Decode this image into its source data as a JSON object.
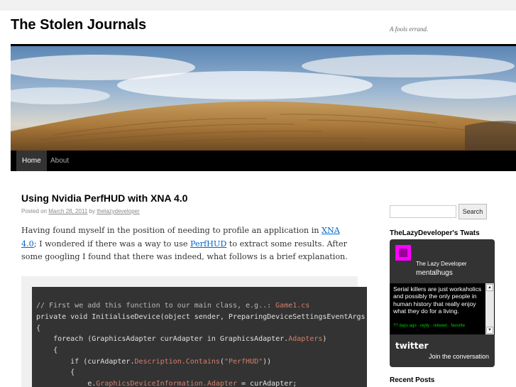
{
  "site": {
    "title": "The Stolen Journals",
    "description": "A fools errand."
  },
  "nav": {
    "items": [
      {
        "label": "Home"
      },
      {
        "label": "About"
      }
    ]
  },
  "post": {
    "title": "Using Nvidia PerfHUD with XNA 4.0",
    "meta_posted_on": "Posted on",
    "meta_date": "March 28, 2011",
    "meta_by": "by",
    "meta_author": "thelazydeveloper",
    "body_part1": "Having found myself in the position of needing to profile an application in ",
    "body_link1": "XNA 4.0",
    "body_part2": "; I wondered if there was a way to use ",
    "body_link2": "PerfHUD",
    "body_part3": " to extract some results. After some googling I found that there was indeed, what follows is a brief explanation."
  },
  "code": {
    "line1_comment": "// First we add this function to our main class, e.g..: ",
    "line1_file": "Game1.cs",
    "line2": "private void InitialiseDevice(object sender, PreparingDeviceSettingsEventArgs e)",
    "line3": "{",
    "line4": "    foreach (GraphicsAdapter curAdapter in GraphicsAdapter.",
    "line4_kw": "Adapters",
    "line4_end": ")",
    "line5": "    {",
    "line6a": "        if (curAdapter.",
    "line6_kw": "Description.Contains",
    "line6b": "(",
    "line6_str": "\"PerfHUD\"",
    "line6c": "))",
    "line7": "        {",
    "line8a": "            e.",
    "line8_kw": "GraphicsDeviceInformation.Adapter",
    "line8b": " = curAdapter;"
  },
  "sidebar": {
    "search_placeholder": "",
    "search_button": "Search",
    "twitter_title": "TheLazyDeveloper's Twats",
    "twitter_name": "The Lazy Developer",
    "twitter_handle": "mentalhugs",
    "tweet_text": "Serial killers are just workaholics and possibly the only people in human history that really enjoy what they do for a living.",
    "tweet_meta": "?? days ago · reply · retweet · favorite",
    "twitter_logo": "twitter",
    "twitter_join": "Join the conversation",
    "recent_posts_title": "Recent Posts"
  },
  "colors": {
    "accent_link": "#0066cc",
    "header_bar": "#000000",
    "twitter_bg": "#333333",
    "avatar": "#ff00ff"
  }
}
